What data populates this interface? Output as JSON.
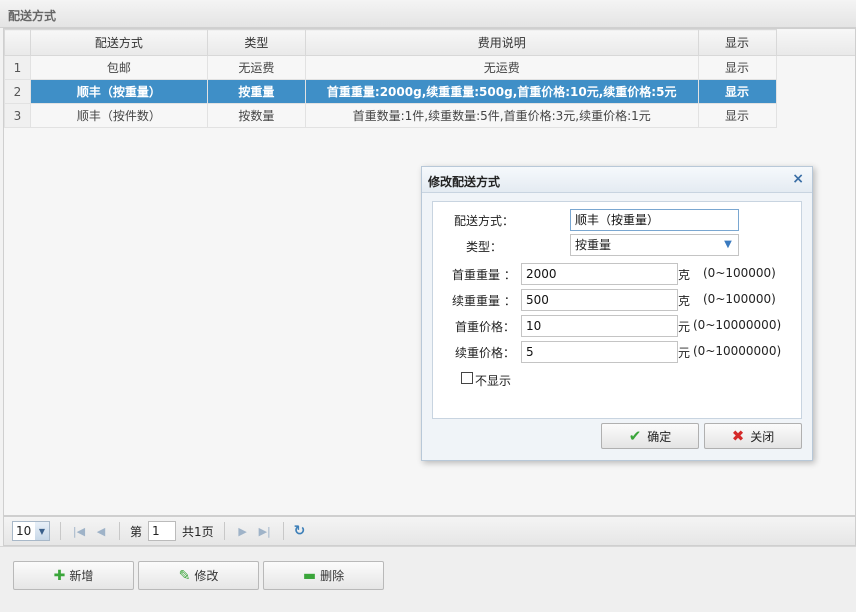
{
  "panel": {
    "title": "配送方式"
  },
  "grid": {
    "columns": [
      "配送方式",
      "类型",
      "费用说明",
      "显示"
    ],
    "rows": [
      {
        "num": "1",
        "name": "包邮",
        "type": "无运费",
        "desc": "无运费",
        "show": "显示",
        "selected": false
      },
      {
        "num": "2",
        "name": "顺丰（按重量）",
        "type": "按重量",
        "desc": "首重重量:2000g,续重重量:500g,首重价格:10元,续重价格:5元",
        "show": "显示",
        "selected": true
      },
      {
        "num": "3",
        "name": "顺丰（按件数）",
        "type": "按数量",
        "desc": "首重数量:1件,续重数量:5件,首重价格:3元,续重价格:1元",
        "show": "显示",
        "selected": false
      }
    ]
  },
  "pager": {
    "page_size": "10",
    "page_prefix": "第",
    "page_value": "1",
    "page_total": "共1页"
  },
  "toolbar": {
    "add_label": "新增",
    "edit_label": "修改",
    "delete_label": "删除"
  },
  "dialog": {
    "title": "修改配送方式",
    "fields": {
      "method_label": "配送方式：",
      "method_value": "顺丰（按重量）",
      "type_label": "类型：",
      "type_value": "按重量",
      "first_weight_label": "首重重量 ：",
      "first_weight_value": "2000",
      "first_weight_unit": "克",
      "first_weight_range": "(0~100000)",
      "next_weight_label": "续重重量 ：",
      "next_weight_value": "500",
      "next_weight_unit": "克",
      "next_weight_range": "(0~100000)",
      "first_price_label": "首重价格：",
      "first_price_value": "10",
      "first_price_unit": "元",
      "first_price_range": "(0~10000000)",
      "next_price_label": "续重价格：",
      "next_price_value": "5",
      "next_price_unit": "元",
      "next_price_range": "(0~10000000)",
      "hide_label": "不显示"
    },
    "ok_label": "确定",
    "close_label": "关闭"
  },
  "colors": {
    "selected_row": "#3f8fc7",
    "link_blue": "#3a6ea5",
    "ok_check": "#3aa53a",
    "close_x": "#d42a2a"
  }
}
